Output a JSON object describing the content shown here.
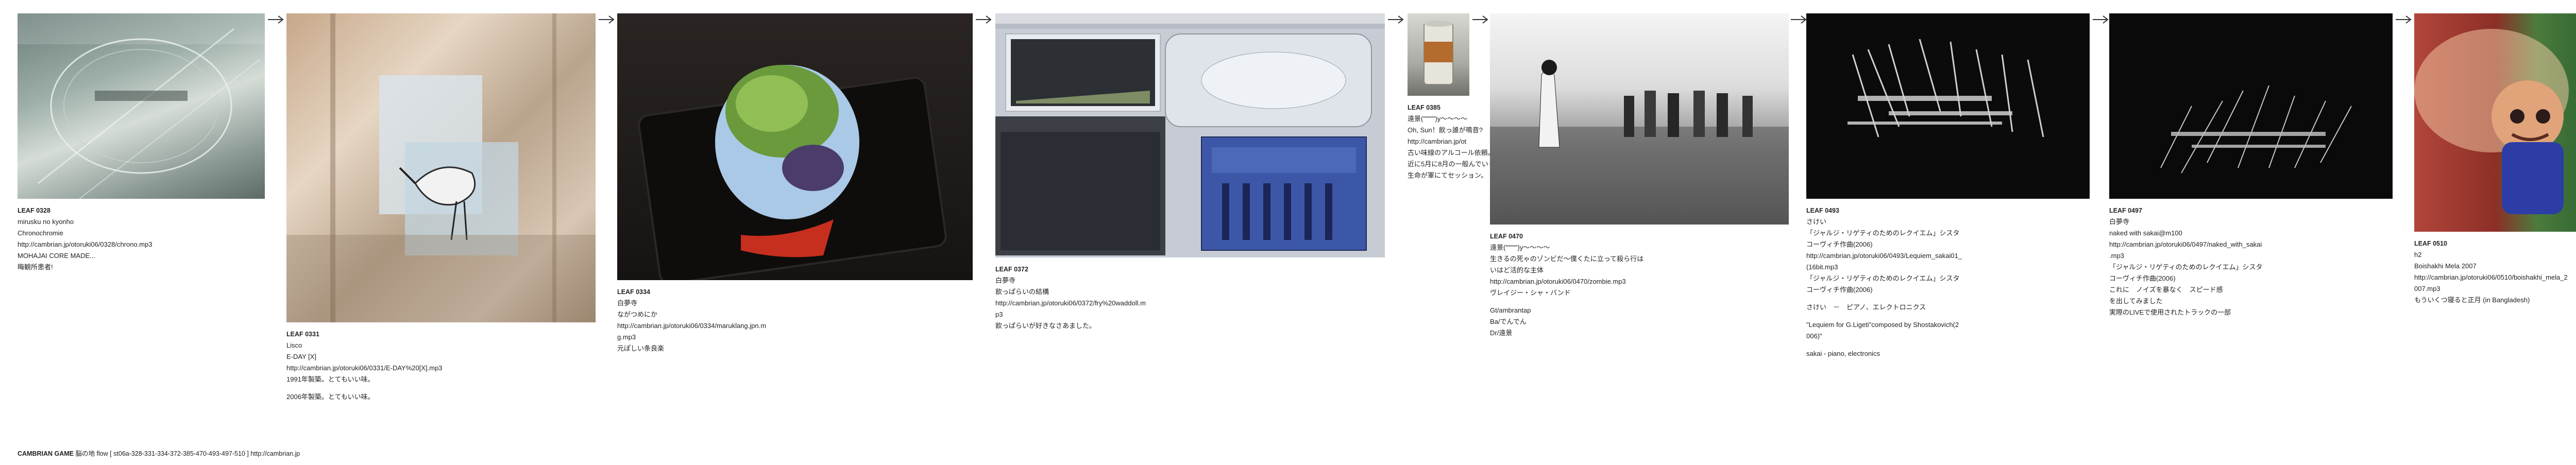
{
  "footer": {
    "title": "CAMBRIAN GAME",
    "sep": "脳の地",
    "flow": "flow [ st06a-328-331-334-372-385-470-493-497-510 ]",
    "url": "http://cambrian.jp"
  },
  "cards": [
    {
      "id": "LEAF 0328",
      "lines": [
        "mirusku no kyonho",
        "Chronochromie",
        "http://cambrian.jp/otoruki06/0328/chrono.mp3",
        "MOHAJAI CORE MADE...",
        "晦観所患者!"
      ],
      "colors": [
        "#7a8a86",
        "#cfd8d2"
      ]
    },
    {
      "id": "LEAF 0331",
      "lines": [
        "Lisco",
        "E-DAY [X]",
        "http://cambrian.jp/otoruki06/0331/E-DAY%20[X].mp3",
        "",
        "1991年製築。とてもいい味。",
        "",
        "2006年製築。とてもいい味。"
      ],
      "colors": [
        "#b89b7a",
        "#e8d6c2"
      ]
    },
    {
      "id": "LEAF 0334",
      "lines": [
        "白夢寺",
        "ながつめにか",
        "http://cambrian.jp/otoruki06/0334/maruklang.jpn.m",
        "g.mp3",
        "元ぽしい条良楽"
      ],
      "colors": [
        "#1e1b1a",
        "#6d8c3c"
      ]
    },
    {
      "id": "LEAF 0372",
      "lines": [
        "白夢寺",
        "飲っぱらいの結構",
        "http://cambrian.jp/otoruki06/0372/fry%20waddoll.m",
        "p3",
        "飲っぱらいが好きなさあました。"
      ],
      "colors": [
        "#8e8a95",
        "#c4c7cf"
      ]
    },
    {
      "id": "LEAF 0385",
      "lines": [
        "遠景(\"\"\"\"\")y〜〜〜〜",
        "Oh, Sun！飲っ誰が鳴音?",
        "http://cambrian.jp/ot",
        "古い味線のアルコール依頼。",
        "近に5月に8月の一般んでいく",
        "生命が軍にてセッション。"
      ],
      "colors": [
        "#74746c",
        "#d4d4cc"
      ]
    },
    {
      "id": "LEAF 0470",
      "lines": [
        "遠景(\"\"\"\"\")y〜〜〜〜",
        "生きるの死ゃのゾンビだ〜僕くたに立って殺ら行は",
        "いはど活的な主体",
        "http://cambrian.jp/otoruki06/0470/zombie.mp3",
        "ヴレイジー・シャ・バンド",
        "",
        "Gt/ambrantap",
        "Ba/でんでん",
        "Dr/遠景"
      ],
      "colors": [
        "#333333",
        "#bdbdbd"
      ]
    },
    {
      "id": "LEAF 0493",
      "lines": [
        "さけい",
        "「ジャルジ・リゲティのためのレクイエム」シスタ",
        "コーヴィチ作曲(2006)",
        "http://cambrian.jp/otoruki06/0493/Lequiem_sakai01_",
        "(16bit.mp3",
        "「ジャルジ・リゲティのためのレクイエム」シスタ",
        "コーヴィチ作曲(2006)",
        "",
        "さけい　－　ピアノ、エレクトロニクス",
        "",
        "\"Lequiem for G.Ligeti\"composed by Shostakovich(2",
        "006)\"",
        "",
        "sakai - piano, electronics"
      ],
      "colors": [
        "#111111",
        "#d8d8d8"
      ]
    },
    {
      "id": "LEAF 0497",
      "lines": [
        "白夢寺",
        "naked with sakai@m100",
        "http://cambrian.jp/otoruki06/0497/naked_with_sakai",
        ".mp3",
        "「ジャルジ・リゲティのためのレクイエム」シスタ",
        "コーヴィチ作曲(2006)",
        "これに　ノイズを暴なく　スピード感",
        "を出してみました",
        "実際のLIVEで使用されたトラックの一部"
      ],
      "colors": [
        "#0f0f0f",
        "#cfcfcf"
      ]
    },
    {
      "id": "LEAF 0510",
      "lines": [
        "h2",
        "Boishakhi Mela 2007",
        "http://cambrian.jp/otoruki06/0510/boishakhi_mela_2",
        "007.mp3",
        "もういくつ寝ると正月 (in Bangladesh)"
      ],
      "colors": [
        "#7d2a25",
        "#2d6a3a"
      ]
    }
  ]
}
